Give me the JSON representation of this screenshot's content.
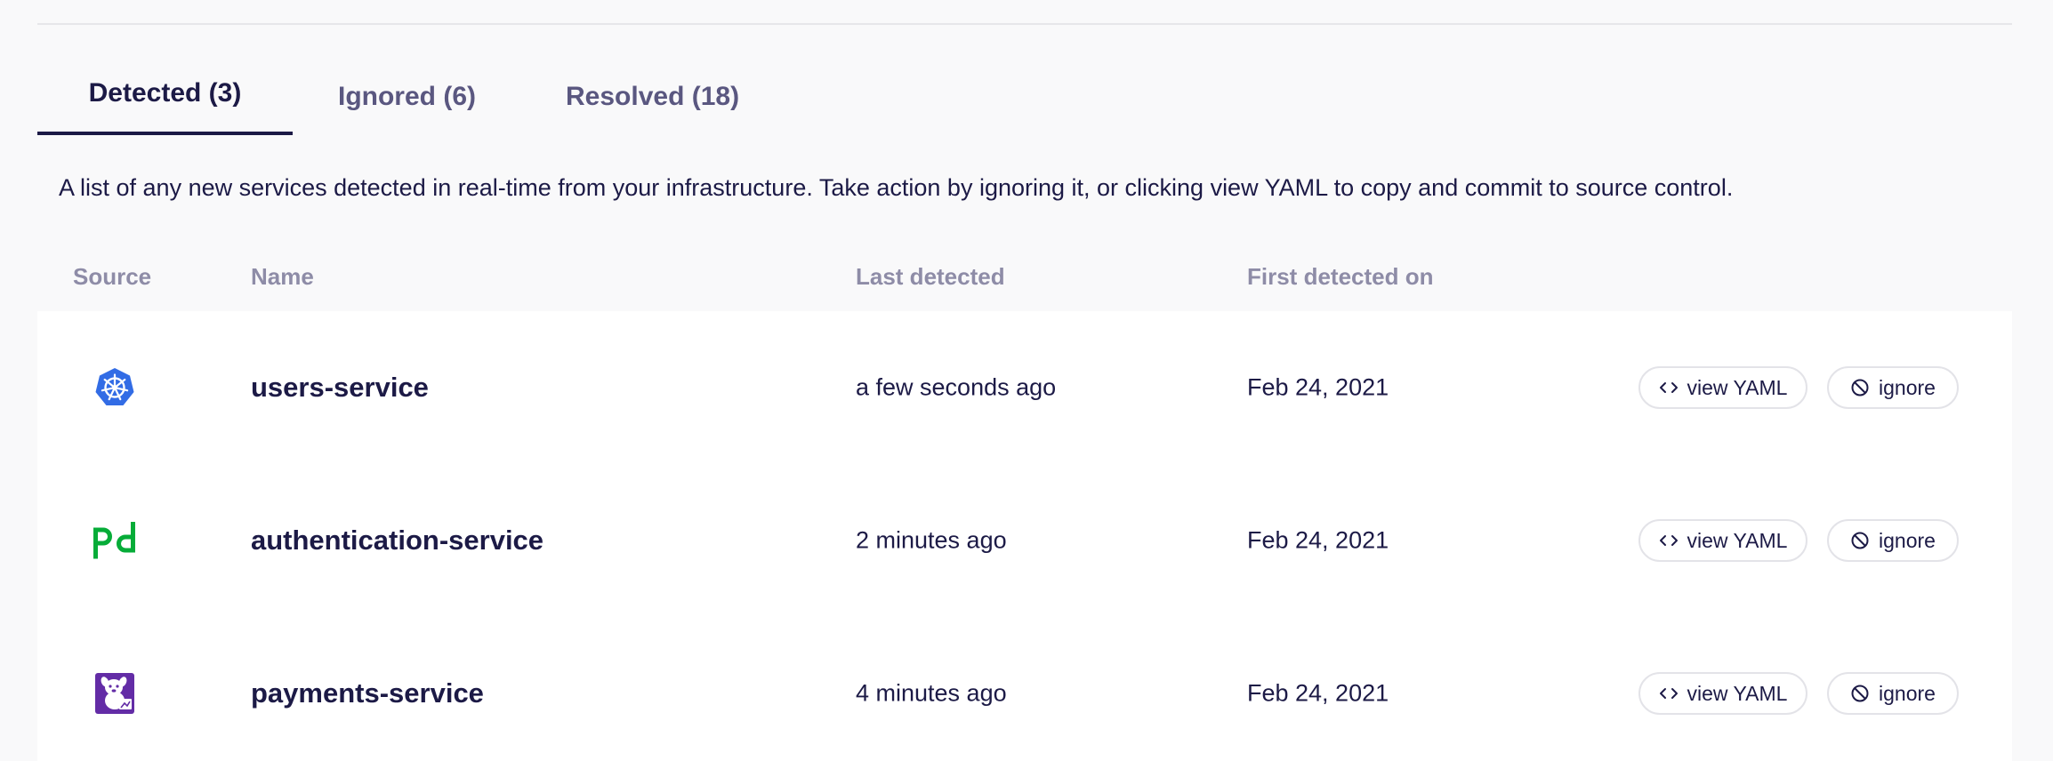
{
  "tabs": [
    {
      "label": "Detected (3)",
      "active": true
    },
    {
      "label": "Ignored (6)",
      "active": false
    },
    {
      "label": "Resolved (18)",
      "active": false
    }
  ],
  "description": "A list of any new services detected in real-time from your infrastructure. Take action by ignoring it, or clicking view YAML to copy and commit to source control.",
  "table": {
    "headers": {
      "source": "Source",
      "name": "Name",
      "last_detected": "Last detected",
      "first_detected_on": "First detected on"
    },
    "rows": [
      {
        "source_icon": "kubernetes-icon",
        "name": "users-service",
        "last_detected": "a few seconds ago",
        "first_detected_on": "Feb 24, 2021",
        "view_yaml_label": "view YAML",
        "ignore_label": "ignore"
      },
      {
        "source_icon": "pagerduty-icon",
        "name": "authentication-service",
        "last_detected": "2 minutes ago",
        "first_detected_on": "Feb 24, 2021",
        "view_yaml_label": "view YAML",
        "ignore_label": "ignore"
      },
      {
        "source_icon": "datadog-icon",
        "name": "payments-service",
        "last_detected": "4 minutes ago",
        "first_detected_on": "Feb 24, 2021",
        "view_yaml_label": "view YAML",
        "ignore_label": "ignore"
      }
    ]
  },
  "colors": {
    "text_primary": "#1c1a46",
    "text_muted": "#8e8ca7",
    "tab_inactive": "#5a5780",
    "kubernetes_blue": "#326ce5",
    "pagerduty_green": "#06ac38",
    "datadog_purple": "#632ca6",
    "background": "#f9f9fa"
  }
}
